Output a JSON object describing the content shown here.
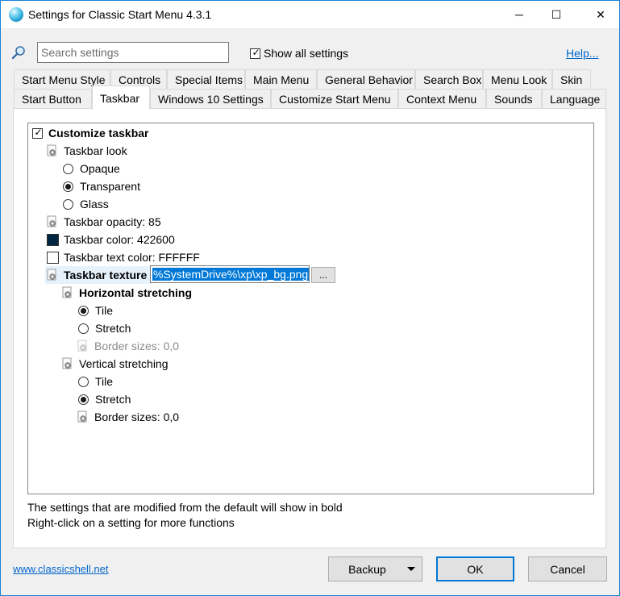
{
  "window": {
    "title": "Settings for Classic Start Menu 4.3.1",
    "controls": {
      "minimize": "─",
      "maximize": "☐",
      "close": "✕"
    }
  },
  "search": {
    "placeholder": "Search settings",
    "value": ""
  },
  "show_all": {
    "label": "Show all settings",
    "checked": true
  },
  "help_link": "Help...",
  "tabs_row1": [
    "Start Menu Style",
    "Controls",
    "Special Items",
    "Main Menu",
    "General Behavior",
    "Search Box",
    "Menu Look",
    "Skin"
  ],
  "tabs_row2": [
    "Start Button",
    "Taskbar",
    "Windows 10 Settings",
    "Customize Start Menu",
    "Context Menu",
    "Sounds",
    "Language"
  ],
  "active_tab": "Taskbar",
  "tree": {
    "customize_taskbar": "Customize taskbar",
    "taskbar_look": "Taskbar look",
    "look_options": [
      "Opaque",
      "Transparent",
      "Glass"
    ],
    "look_selected": "Transparent",
    "opacity": "Taskbar opacity: 85",
    "color": "Taskbar color: 422600",
    "text_color": "Taskbar text color: FFFFFF",
    "texture_label": "Taskbar texture",
    "texture_value": "%SystemDrive%\\xp\\xp_bg.png",
    "browse": "...",
    "horizontal": "Horizontal stretching",
    "h_tile": "Tile",
    "h_stretch": "Stretch",
    "h_border": "Border sizes: 0,0",
    "vertical": "Vertical stretching",
    "v_tile": "Tile",
    "v_stretch": "Stretch",
    "v_border": "Border sizes: 0,0"
  },
  "colors": {
    "taskbar": "#002642",
    "text": "#FFFFFF",
    "accent": "#0078d7"
  },
  "info": {
    "line1": "The settings that are modified from the default will show in bold",
    "line2": "Right-click on a setting for more functions"
  },
  "footer": {
    "site": "www.classicshell.net",
    "backup": "Backup",
    "ok": "OK",
    "cancel": "Cancel"
  }
}
